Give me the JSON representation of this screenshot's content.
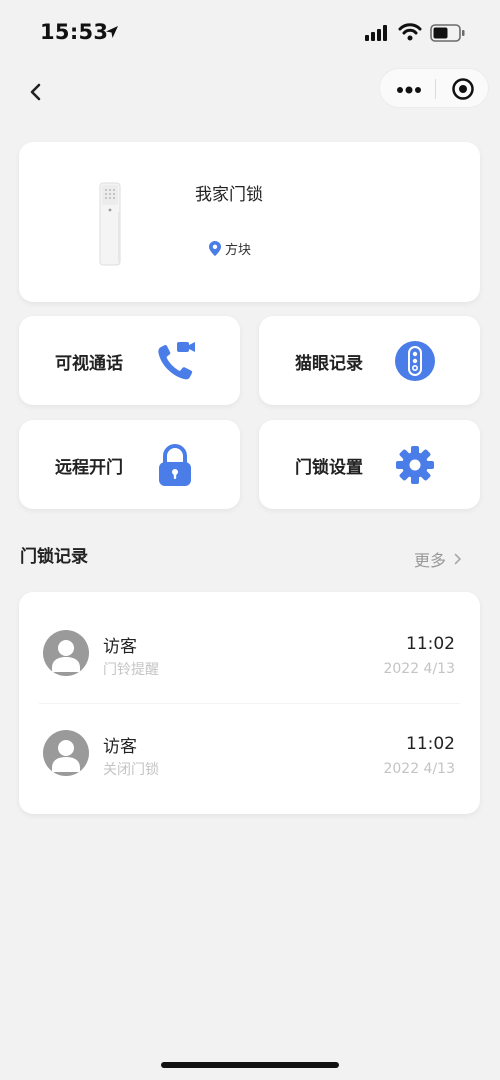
{
  "status_bar": {
    "time": "15:53"
  },
  "hero": {
    "title": "我家门锁",
    "location": "方块"
  },
  "tiles": [
    {
      "label": "可视通话",
      "icon": "video-call-icon"
    },
    {
      "label": "猫眼记录",
      "icon": "peephole-icon"
    },
    {
      "label": "远程开门",
      "icon": "padlock-icon"
    },
    {
      "label": "门锁设置",
      "icon": "gear-icon"
    }
  ],
  "records_section": {
    "title": "门锁记录",
    "more_label": "更多"
  },
  "records": [
    {
      "name": "访客",
      "desc": "门铃提醒",
      "time": "11:02",
      "date": "2022 4/13"
    },
    {
      "name": "访客",
      "desc": "关闭门锁",
      "time": "11:02",
      "date": "2022 4/13"
    }
  ],
  "colors": {
    "accent": "#4a7de8",
    "background": "#f2f2f2",
    "muted_text": "#c4c4c4"
  }
}
